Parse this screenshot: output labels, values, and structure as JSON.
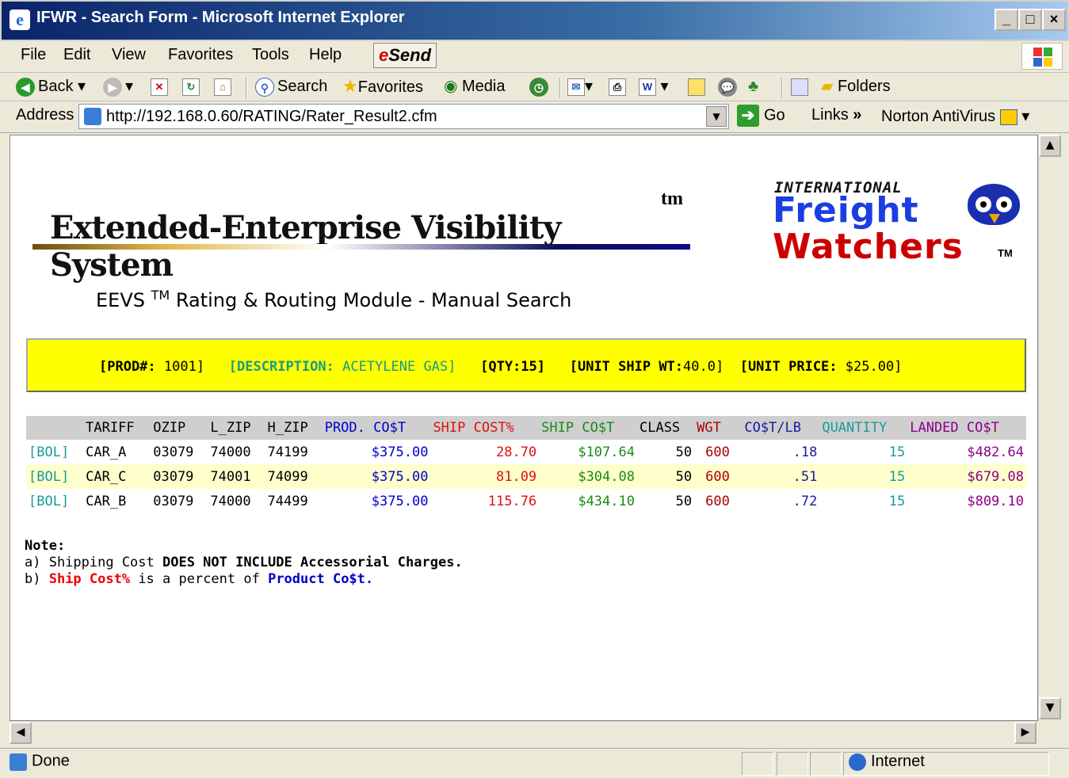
{
  "window": {
    "title": "IFWR - Search Form - Microsoft Internet Explorer"
  },
  "menu": [
    "File",
    "Edit",
    "View",
    "Favorites",
    "Tools",
    "Help"
  ],
  "send_label": "Send",
  "toolbar": {
    "back": "Back",
    "search": "Search",
    "favorites": "Favorites",
    "media": "Media",
    "folders": "Folders"
  },
  "address": {
    "label": "Address",
    "url": "http://192.168.0.60/RATING/Rater_Result2.cfm",
    "go": "Go",
    "links": "Links",
    "norton": "Norton AntiVirus"
  },
  "banner": {
    "title": "Extended-Enterprise Visibility System",
    "tm": "tm"
  },
  "logo": {
    "line1": "INTERNATIONAL",
    "line2": "Freight",
    "line3": "Watchers",
    "tm": "TM"
  },
  "subtitle": {
    "pre": "EEVS ",
    "tm": "TM",
    "post": " Rating & Routing Module - Manual Search"
  },
  "product": {
    "prod_label": "[PROD#:",
    "prod_value": " 1001]",
    "desc_label": "[DESCRIPTION:",
    "desc_value": " ACETYLENE GAS]",
    "qty_label": "[QTY:",
    "qty_value": "15]",
    "wt_label": "[UNIT SHIP WT:",
    "wt_value": "40.0]",
    "price_label": "[UNIT PRICE:",
    "price_value": " $25.00]"
  },
  "table": {
    "headers": [
      "",
      "TARIFF",
      "OZIP",
      "L_ZIP",
      "H_ZIP",
      "PROD. CO$T",
      "SHIP COST%",
      "SHIP CO$T",
      "CLASS",
      "WGT",
      "CO$T/LB",
      "QUANTITY",
      "LANDED CO$T"
    ],
    "rows": [
      [
        "[BOL]",
        "CAR_A",
        "03079",
        "74000",
        "74199",
        "$375.00",
        "28.70",
        "$107.64",
        "50",
        "600",
        ".18",
        "15",
        "$482.64"
      ],
      [
        "[BOL]",
        "CAR_C",
        "03079",
        "74001",
        "74099",
        "$375.00",
        "81.09",
        "$304.08",
        "50",
        "600",
        ".51",
        "15",
        "$679.08"
      ],
      [
        "[BOL]",
        "CAR_B",
        "03079",
        "74000",
        "74499",
        "$375.00",
        "115.76",
        "$434.10",
        "50",
        "600",
        ".72",
        "15",
        "$809.10"
      ]
    ]
  },
  "notes": {
    "title": "Note:",
    "a_pre": "a) Shipping Cost ",
    "a_bold": "DOES NOT INCLUDE Accessorial Charges.",
    "b_pre": "b) ",
    "b_red": "Ship Cost%",
    "b_mid": " is a percent of ",
    "b_blue": "Product Co$t."
  },
  "status": {
    "text": "Done",
    "zone": "Internet"
  }
}
